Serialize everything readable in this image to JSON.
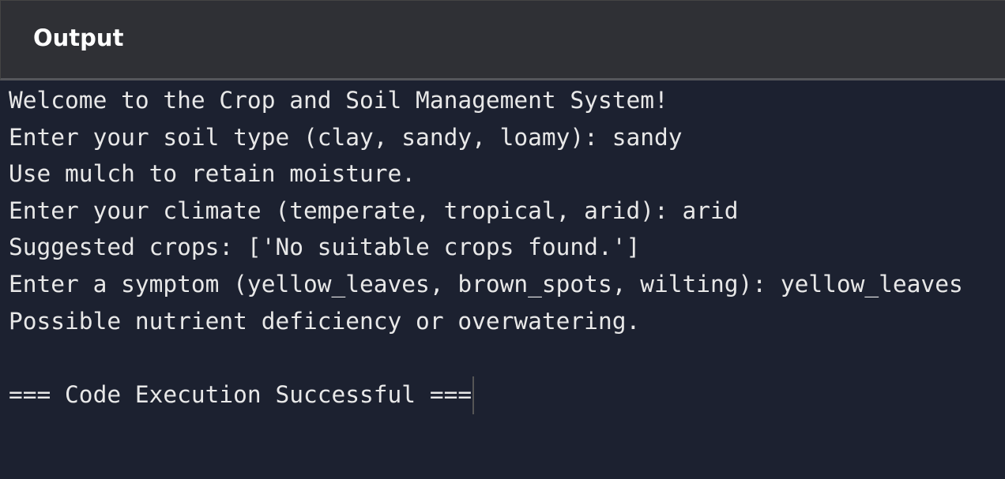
{
  "header": {
    "title": "Output"
  },
  "output": {
    "lines": [
      "Welcome to the Crop and Soil Management System!",
      "Enter your soil type (clay, sandy, loamy): sandy",
      "Use mulch to retain moisture.",
      "Enter your climate (temperate, tropical, arid): arid",
      "Suggested crops: ['No suitable crops found.']",
      "Enter a symptom (yellow_leaves, brown_spots, wilting): yellow_leaves",
      "Possible nutrient deficiency or overwatering.",
      "",
      "=== Code Execution Successful ==="
    ]
  }
}
